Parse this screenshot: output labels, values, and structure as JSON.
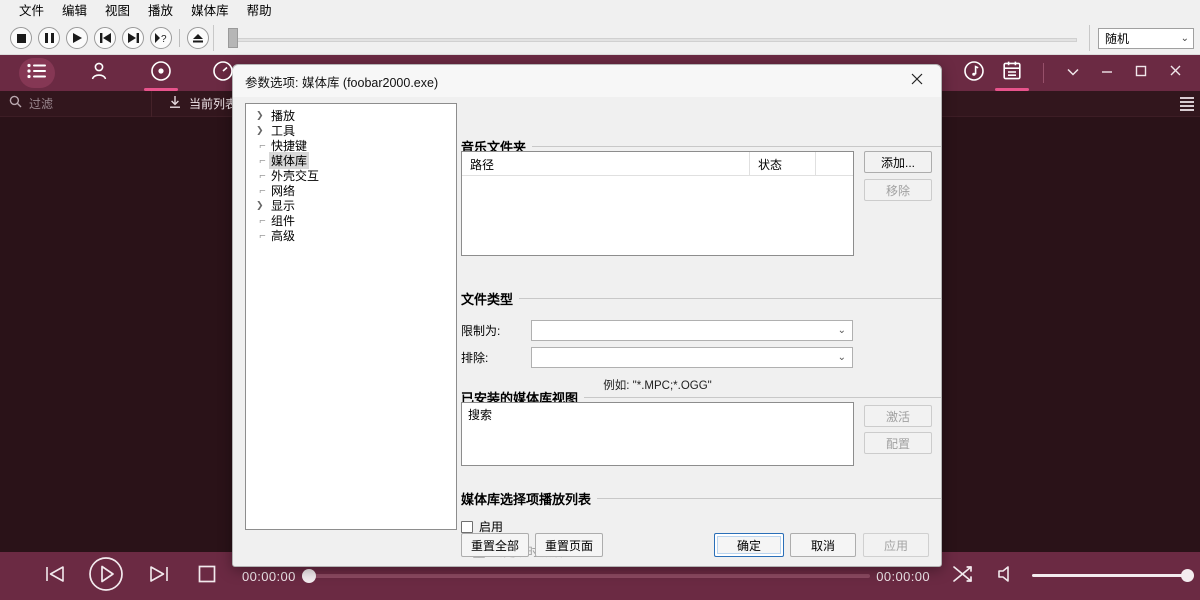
{
  "menubar": {
    "items": [
      {
        "label": "文件"
      },
      {
        "label": "编辑"
      },
      {
        "label": "视图"
      },
      {
        "label": "播放"
      },
      {
        "label": "媒体库"
      },
      {
        "label": "帮助"
      }
    ]
  },
  "player_toolbar": {
    "buttons": [
      {
        "name": "stop-button",
        "icon": "stop-icon"
      },
      {
        "name": "pause-button",
        "icon": "pause-icon"
      },
      {
        "name": "play-button",
        "icon": "play-icon"
      },
      {
        "name": "previous-button",
        "icon": "previous-icon"
      },
      {
        "name": "next-button",
        "icon": "next-icon"
      },
      {
        "name": "random-button",
        "icon": "play-random-icon"
      },
      {
        "name": "eject-button",
        "icon": "eject-icon"
      }
    ],
    "playback_order": {
      "value": "随机",
      "chevron": "⌄"
    }
  },
  "navbar": {
    "left_items": [
      {
        "name": "playlist-view-tab",
        "icon": "list-icon",
        "active": false,
        "chip": true
      },
      {
        "name": "artist-view-tab",
        "icon": "person-icon",
        "active": false,
        "chip": false
      },
      {
        "name": "album-view-tab",
        "icon": "disc-icon",
        "active": true,
        "chip": false
      },
      {
        "name": "recent-view-tab",
        "icon": "speedometer-icon",
        "active": false,
        "chip": false
      }
    ],
    "right_items": [
      {
        "name": "now-playing-tab",
        "icon": "music-note-icon",
        "active": false
      },
      {
        "name": "properties-tab",
        "icon": "clipboard-icon",
        "active": true
      }
    ],
    "window_buttons": [
      {
        "name": "more-button",
        "glyph": "⌄"
      },
      {
        "name": "minimize-button",
        "glyph": "—"
      },
      {
        "name": "maximize-button",
        "glyph": "▢"
      },
      {
        "name": "close-button",
        "glyph": "✕"
      }
    ]
  },
  "strip": {
    "filter_placeholder": "过滤",
    "search_icon": "search-icon",
    "playlist_button": {
      "label": "当前列表",
      "icon": "download-icon"
    }
  },
  "dialog": {
    "title": "参数选项: 媒体库 (foobar2000.exe)",
    "close_glyph": "✕",
    "tree": [
      {
        "label": "播放",
        "expandable": true,
        "selected": false
      },
      {
        "label": "工具",
        "expandable": true,
        "selected": false
      },
      {
        "label": "快捷键",
        "expandable": false,
        "selected": false
      },
      {
        "label": "媒体库",
        "expandable": false,
        "selected": true
      },
      {
        "label": "外壳交互",
        "expandable": false,
        "selected": false
      },
      {
        "label": "网络",
        "expandable": false,
        "selected": false
      },
      {
        "label": "显示",
        "expandable": true,
        "selected": false
      },
      {
        "label": "组件",
        "expandable": false,
        "selected": false
      },
      {
        "label": "高级",
        "expandable": false,
        "selected": false
      }
    ],
    "music_folders": {
      "title": "音乐文件夹",
      "columns": [
        "路径",
        "状态"
      ],
      "rows": [],
      "add_button": "添加...",
      "remove_button": "移除"
    },
    "file_types": {
      "title": "文件类型",
      "restrict_label": "限制为:",
      "restrict_value": "",
      "exclude_label": "排除:",
      "exclude_value": "",
      "hint": "例如: \"*.MPC;*.OGG\"",
      "chevron": "⌄"
    },
    "library_views": {
      "title": "已安装的媒体库视图",
      "items": [
        "搜索"
      ],
      "activate_button": "激活",
      "configure_button": "配置"
    },
    "selection_playlist": {
      "title": "媒体库选择项播放列表",
      "enable_label": "启用",
      "enable_checked": false,
      "activate_on_change_label": "当更改时激活",
      "activate_on_change_checked": true
    },
    "footer": {
      "reset_all": "重置全部",
      "reset_page": "重置页面",
      "ok": "确定",
      "cancel": "取消",
      "apply": "应用"
    }
  },
  "bottom_bar": {
    "previous_icon": "previous-track-icon",
    "play_icon": "play-circle-icon",
    "next_icon": "next-track-icon",
    "stop_icon": "stop-square-icon",
    "elapsed_time": "00:00:00",
    "total_time": "00:00:00",
    "shuffle_icon": "shuffle-icon",
    "volume_icon": "speaker-icon",
    "seek_percent": 0,
    "volume_percent": 100
  },
  "colors": {
    "accent_purple": "#6b2a43",
    "accent_pink": "#e8538c",
    "dark_bg": "#2a1218",
    "strip_bg": "#32161d",
    "dialog_bg": "#f0f0f0"
  }
}
